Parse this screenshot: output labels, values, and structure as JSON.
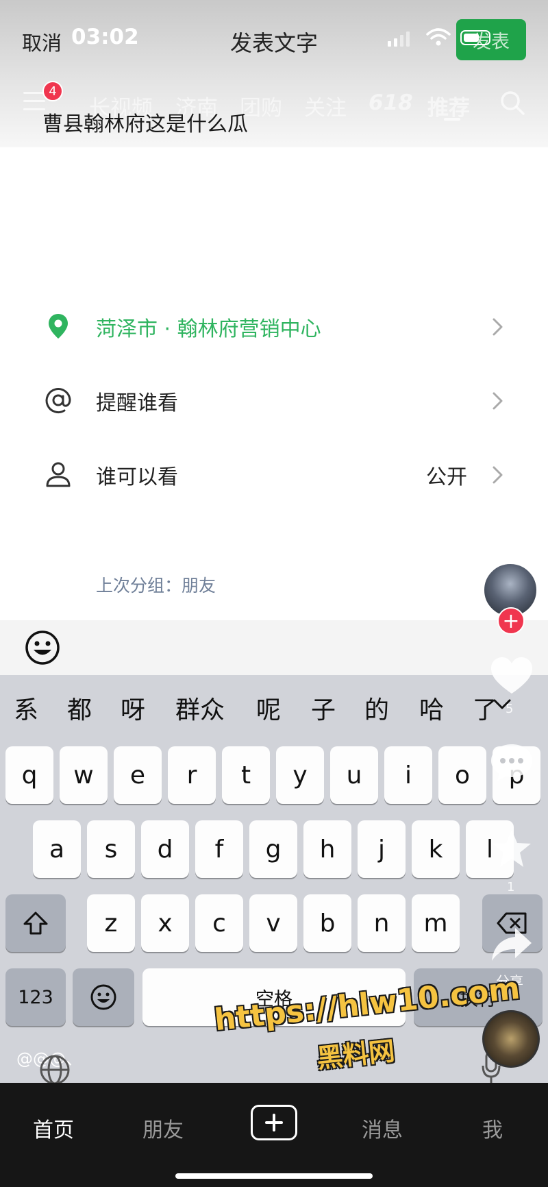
{
  "status_bar": {
    "time": "03:02"
  },
  "header": {
    "cancel_label": "取消",
    "title": "发表文字",
    "publish_label": "发表"
  },
  "background_video": {
    "notification_count": "4",
    "nav_tabs": [
      "长视频",
      "济南",
      "团购",
      "关注",
      "618",
      "推荐"
    ],
    "side_rail": {
      "like_count": "5",
      "favorite_count": "1",
      "share_label": "分享"
    }
  },
  "post": {
    "text": "曹县翰林府这是什么瓜"
  },
  "options": [
    {
      "label": "菏泽市 · 翰林府营销中心",
      "value": "",
      "icon": "location-pin-icon"
    },
    {
      "label": "提醒谁看",
      "value": "",
      "icon": "at-icon"
    },
    {
      "label": "谁可以看",
      "value": "公开",
      "icon": "person-icon"
    }
  ],
  "last_group": "上次分组：朋友",
  "keyboard": {
    "candidates": [
      "系",
      "都",
      "呀",
      "群众",
      "呢",
      "子",
      "的",
      "哈",
      "了"
    ],
    "rows": [
      [
        "q",
        "w",
        "e",
        "r",
        "t",
        "y",
        "u",
        "i",
        "o",
        "p"
      ],
      [
        "a",
        "s",
        "d",
        "f",
        "g",
        "h",
        "j",
        "k",
        "l"
      ],
      [
        "z",
        "x",
        "c",
        "v",
        "b",
        "n",
        "m"
      ]
    ],
    "numbers_label": "123",
    "space_label": "空格",
    "return_label": "换行",
    "hint": "@@@、"
  },
  "watermark": {
    "url": "https://hlw10.com",
    "name": "黑料网"
  },
  "tabbar": {
    "tabs": [
      "首页",
      "朋友",
      "消息",
      "我"
    ],
    "active": "首页"
  },
  "colors": {
    "accent_green": "#1fa34a",
    "location_green": "#2fb45f",
    "badge_red": "#f0364f",
    "tabbar_bg": "#161616"
  }
}
